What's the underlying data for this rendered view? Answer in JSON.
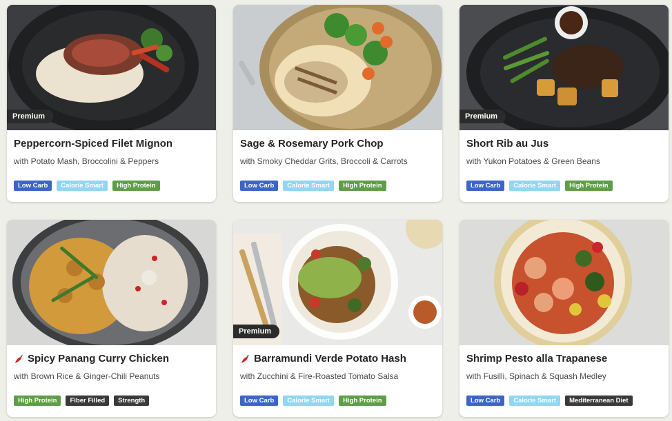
{
  "premium_label": "Premium",
  "colors": {
    "low_carb": "#3d65c6",
    "calorie_smart": "#92d6f2",
    "high_protein": "#5f9e48",
    "dark_tag": "#3a3a3a",
    "premium_badge": "#2b2b2b"
  },
  "meals": [
    {
      "title": "Peppercorn-Spiced Filet Mignon",
      "subtitle": "with Potato Mash, Broccolini & Peppers",
      "premium": true,
      "spicy": false,
      "tags": [
        "Low Carb",
        "Calorie Smart",
        "High Protein"
      ]
    },
    {
      "title": "Sage & Rosemary Pork Chop",
      "subtitle": "with Smoky Cheddar Grits, Broccoli & Carrots",
      "premium": false,
      "spicy": false,
      "tags": [
        "Low Carb",
        "Calorie Smart",
        "High Protein"
      ]
    },
    {
      "title": "Short Rib au Jus",
      "subtitle": "with Yukon Potatoes & Green Beans",
      "premium": true,
      "spicy": false,
      "tags": [
        "Low Carb",
        "Calorie Smart",
        "High Protein"
      ]
    },
    {
      "title": "Spicy Panang Curry Chicken",
      "subtitle": "with Brown Rice & Ginger-Chili Peanuts",
      "premium": false,
      "spicy": true,
      "tags": [
        "High Protein",
        "Fiber Filled",
        "Strength"
      ]
    },
    {
      "title": "Barramundi Verde Potato Hash",
      "subtitle": "with Zucchini & Fire-Roasted Tomato Salsa",
      "premium": true,
      "spicy": true,
      "tags": [
        "Low Carb",
        "Calorie Smart",
        "High Protein"
      ]
    },
    {
      "title": "Shrimp Pesto alla Trapanese",
      "subtitle": "with Fusilli, Spinach & Squash Medley",
      "premium": false,
      "spicy": false,
      "tags": [
        "Low Carb",
        "Calorie Smart",
        "Mediterranean Diet"
      ]
    }
  ]
}
